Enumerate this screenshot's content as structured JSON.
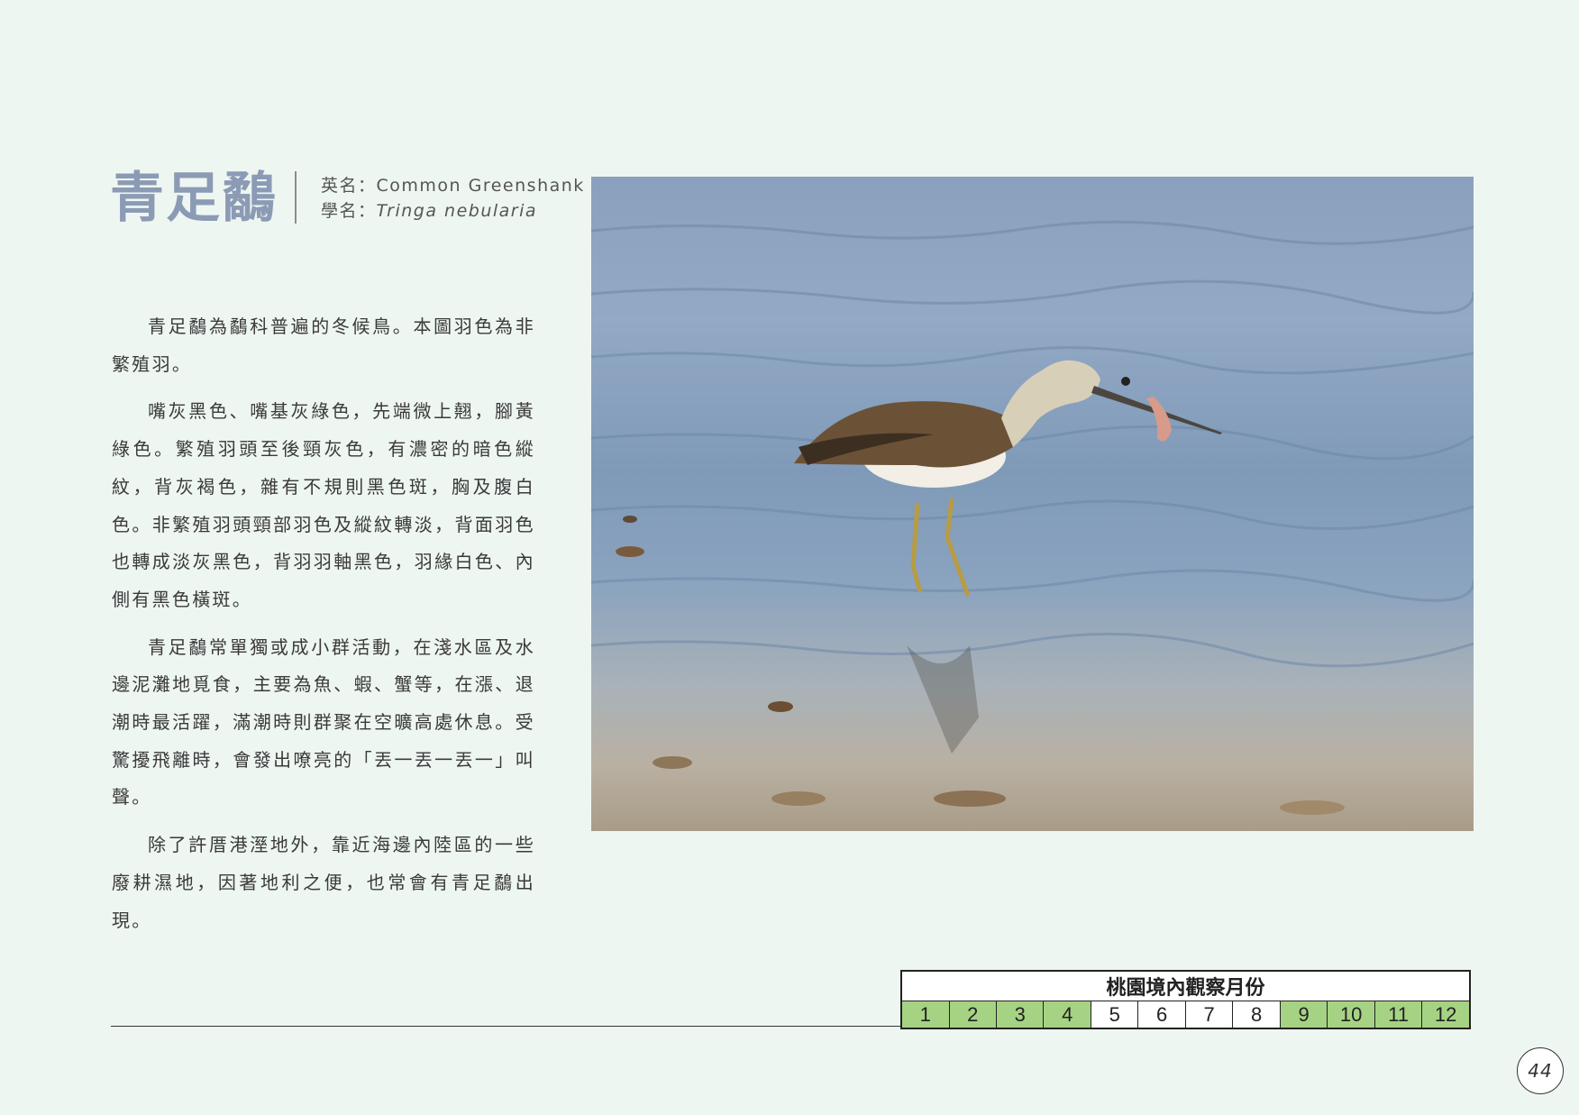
{
  "species": {
    "title": "青足鷸",
    "english_name_label": "英名：",
    "english_name": "Common Greenshank",
    "scientific_name_label": "學名：",
    "scientific_name": "Tringa nebularia"
  },
  "description": {
    "paragraphs": [
      "青足鷸為鷸科普遍的冬候鳥。本圖羽色為非繁殖羽。",
      "嘴灰黑色、嘴基灰綠色，先端微上翹，腳黃綠色。繁殖羽頭至後頸灰色，有濃密的暗色縱紋，背灰褐色，雜有不規則黑色斑，胸及腹白色。非繁殖羽頭頸部羽色及縱紋轉淡，背面羽色也轉成淡灰黑色，背羽羽軸黑色，羽緣白色、內側有黑色橫斑。",
      "青足鷸常單獨或成小群活動，在淺水區及水邊泥灘地覓食，主要為魚、蝦、蟹等，在漲、退潮時最活躍，滿潮時則群聚在空曠高處休息。受驚擾飛離時，會發出嘹亮的「丟一丟一丟一」叫聲。",
      "除了許厝港溼地外，靠近海邊內陸區的一些廢耕濕地，因著地利之便，也常會有青足鷸出現。"
    ]
  },
  "photo": {
    "subject": "Common Greenshank wading in shallow water holding a small crab"
  },
  "observation": {
    "title": "桃園境內觀察月份",
    "months": [
      {
        "label": "1",
        "observed": true
      },
      {
        "label": "2",
        "observed": true
      },
      {
        "label": "3",
        "observed": true
      },
      {
        "label": "4",
        "observed": true
      },
      {
        "label": "5",
        "observed": false
      },
      {
        "label": "6",
        "observed": false
      },
      {
        "label": "7",
        "observed": false
      },
      {
        "label": "8",
        "observed": false
      },
      {
        "label": "9",
        "observed": true
      },
      {
        "label": "10",
        "observed": true
      },
      {
        "label": "11",
        "observed": true
      },
      {
        "label": "12",
        "observed": true
      }
    ],
    "observed_color": "#a6d383"
  },
  "page": {
    "number": "44"
  }
}
